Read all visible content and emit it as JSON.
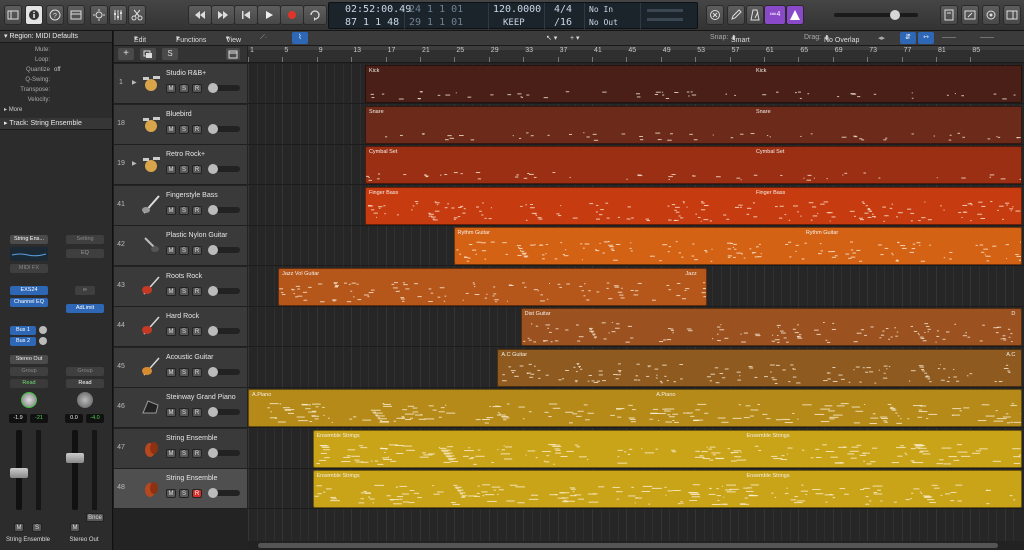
{
  "lcd": {
    "time": "02:52:00.49",
    "bars": "87  1  1    48",
    "time_sub": "24  1  1    01",
    "bars_sub": "29  1  1    01",
    "tempo": "120.0000",
    "tempo_mode": "KEEP",
    "signature": "4/4",
    "division": "/16",
    "midi_in": "No In",
    "midi_out": "No Out"
  },
  "control": {
    "badge": "≔4",
    "master_volume": 0.75
  },
  "inspector": {
    "region_header": "Region: MIDI Defaults",
    "rows": [
      {
        "k": "Mute:",
        "v": ""
      },
      {
        "k": "Loop:",
        "v": ""
      },
      {
        "k": "Quantize",
        "v": "off"
      },
      {
        "k": "Q-Swing:",
        "v": ""
      },
      {
        "k": "Transpose:",
        "v": ""
      },
      {
        "k": "Velocity:",
        "v": ""
      }
    ],
    "more": "More",
    "track_header": "Track:  String Ensemble",
    "strip_left": {
      "setting": "String Ens...",
      "midi_fx": "MIDI FX",
      "instrument": "EXS24",
      "eq": "Channel EQ",
      "bus1": "Bus 1",
      "bus2": "Bus 2",
      "output": "Stereo Out",
      "group": "Group",
      "automation": "Read",
      "vol": "-1.9",
      "peak": "-21",
      "mute": "M",
      "solo": "S",
      "name": "String Ensemble"
    },
    "strip_right": {
      "setting": "Setting",
      "eq": "EQ",
      "link": "∞",
      "insert": "AdLimit",
      "group": "Group",
      "automation": "Read",
      "vol": "0.0",
      "peak": "-4.0",
      "mute": "M",
      "bounce": "Bnce",
      "name": "Stereo Out"
    }
  },
  "toolbar": {
    "edit": "Edit",
    "functions": "Functions",
    "view": "View",
    "snap_label": "Snap:",
    "snap_value": "Smart",
    "drag_label": "Drag:",
    "drag_value": "No Overlap"
  },
  "ruler": {
    "bars": [
      "1",
      "5",
      "9",
      "13",
      "17",
      "21",
      "25",
      "29",
      "33",
      "37",
      "41",
      "45",
      "49",
      "53",
      "57",
      "61",
      "65",
      "69",
      "73",
      "77",
      "81",
      "85"
    ]
  },
  "tracks": [
    {
      "num": "1",
      "name": "Studio R&B+",
      "icon": "drum-kit-icon",
      "folder": true,
      "rec": false
    },
    {
      "num": "18",
      "name": "Bluebird",
      "icon": "drum-kit-icon",
      "folder": false,
      "rec": false
    },
    {
      "num": "19",
      "name": "Retro Rock+",
      "icon": "drum-kit-icon",
      "folder": true,
      "rec": false
    },
    {
      "num": "41",
      "name": "Fingerstyle Bass",
      "icon": "bass-guitar-icon",
      "folder": false,
      "rec": false
    },
    {
      "num": "42",
      "name": "Plastic Nylon Guitar",
      "icon": "nylon-guitar-icon",
      "folder": false,
      "rec": false
    },
    {
      "num": "43",
      "name": "Roots Rock",
      "icon": "electric-guitar-icon",
      "folder": false,
      "rec": false
    },
    {
      "num": "44",
      "name": "Hard Rock",
      "icon": "electric-guitar-icon",
      "folder": false,
      "rec": false
    },
    {
      "num": "45",
      "name": "Acoustic Guitar",
      "icon": "acoustic-guitar-icon",
      "folder": false,
      "rec": false
    },
    {
      "num": "46",
      "name": "Steinway Grand Piano",
      "icon": "piano-icon",
      "folder": false,
      "rec": false
    },
    {
      "num": "47",
      "name": "String Ensemble",
      "icon": "strings-icon",
      "folder": false,
      "rec": false
    },
    {
      "num": "48",
      "name": "String Ensemble",
      "icon": "strings-icon",
      "folder": false,
      "rec": true
    }
  ],
  "regions": [
    {
      "track": 0,
      "color": "#4a1f17",
      "parts": [
        {
          "label": "Kick",
          "start": 13.6,
          "end": 58.6
        },
        {
          "label": "Kick",
          "start": 58.6,
          "end": 90
        }
      ]
    },
    {
      "track": 1,
      "color": "#6b2a1a",
      "parts": [
        {
          "label": "Snare",
          "start": 13.6,
          "end": 58.6
        },
        {
          "label": "Snare",
          "start": 58.6,
          "end": 90
        }
      ]
    },
    {
      "track": 2,
      "color": "#9a2f14",
      "parts": [
        {
          "label": "Cymbal Set",
          "start": 13.6,
          "end": 58.6
        },
        {
          "label": "Cymbal Set",
          "start": 58.6,
          "end": 90
        }
      ]
    },
    {
      "track": 3,
      "color": "#c63b10",
      "parts": [
        {
          "label": "Finger Bass",
          "start": 13.6,
          "end": 58.6
        },
        {
          "label": "Finger Bass",
          "start": 58.6,
          "end": 90
        }
      ]
    },
    {
      "track": 4,
      "color": "#d46215",
      "parts": [
        {
          "label": "Rythm Guitar",
          "start": 23.9,
          "end": 64.4
        },
        {
          "label": "Rythm Guitar",
          "start": 64.4,
          "end": 90
        }
      ]
    },
    {
      "track": 5,
      "color": "#b5561b",
      "parts": [
        {
          "label": "Jazz Vol Guitar",
          "start": 3.5,
          "end": 50.4
        },
        {
          "label": "Jazz",
          "start": 50.4,
          "end": 53.4
        }
      ]
    },
    {
      "track": 6,
      "color": "#9b5220",
      "parts": [
        {
          "label": "Dist Guitar",
          "start": 31.7,
          "end": 88.3
        },
        {
          "label": "D",
          "start": 88.3,
          "end": 90
        }
      ]
    },
    {
      "track": 7,
      "color": "#8e5a1f",
      "parts": [
        {
          "label": "A.C Guitar",
          "start": 29.0,
          "end": 87.7
        },
        {
          "label": "A.C",
          "start": 87.7,
          "end": 90
        }
      ]
    },
    {
      "track": 8,
      "color": "#b58a19",
      "parts": [
        {
          "label": "A.Piano",
          "start": 0.0,
          "end": 47.0
        },
        {
          "label": "A.Piano",
          "start": 47.0,
          "end": 90
        }
      ]
    },
    {
      "track": 9,
      "color": "#c9a318",
      "parts": [
        {
          "label": "Ensemble Strings",
          "start": 7.5,
          "end": 57.5
        },
        {
          "label": "Ensemble Strings",
          "start": 57.5,
          "end": 90
        }
      ]
    },
    {
      "track": 10,
      "color": "#c9a318",
      "parts": [
        {
          "label": "Ensemble Strings",
          "start": 7.5,
          "end": 57.5
        },
        {
          "label": "Ensemble Strings",
          "start": 57.5,
          "end": 90
        }
      ]
    }
  ]
}
